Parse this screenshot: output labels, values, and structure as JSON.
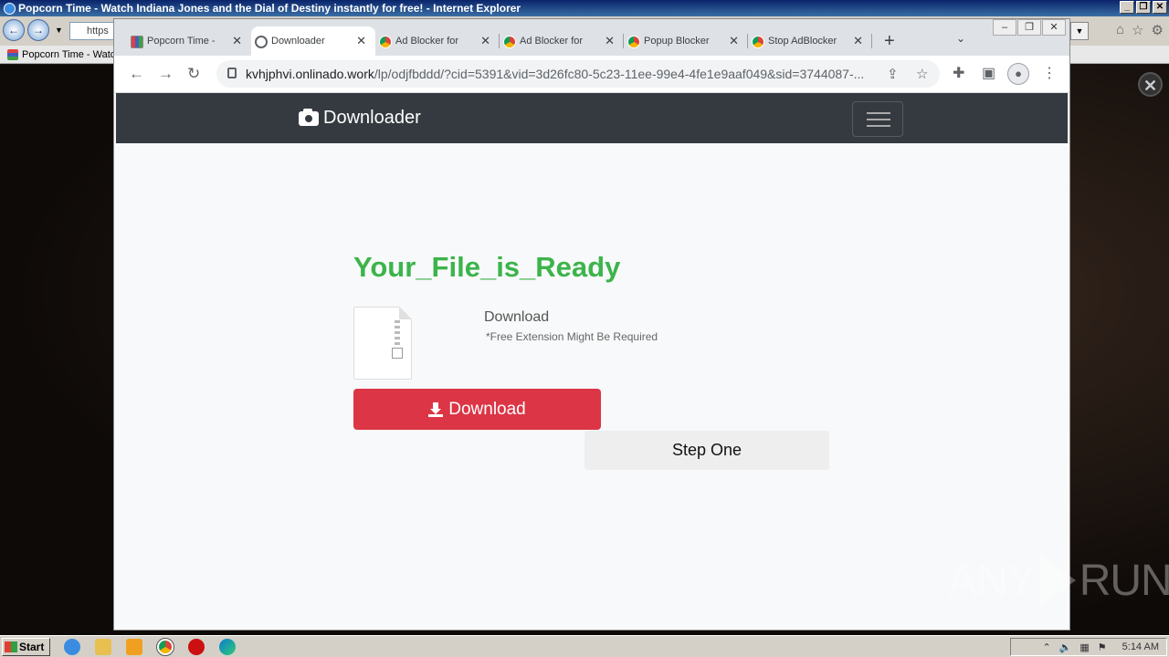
{
  "ie": {
    "title": "Popcorn Time - Watch Indiana Jones and the Dial of Destiny instantly for free! - Internet Explorer",
    "address_partial": "https",
    "tab_label": "Popcorn Time - Watc",
    "close_overlay": "✕"
  },
  "chrome": {
    "tabs": [
      {
        "label": "Popcorn Time -",
        "favicon": "popcorn-icon",
        "active": false
      },
      {
        "label": "Downloader",
        "favicon": "globe-icon",
        "active": true
      },
      {
        "label": "Ad Blocker for",
        "favicon": "chromium-icon",
        "active": false
      },
      {
        "label": "Ad Blocker for",
        "favicon": "chromium-icon",
        "active": false
      },
      {
        "label": "Popup Blocker",
        "favicon": "chromium-icon",
        "active": false
      },
      {
        "label": "Stop AdBlocker",
        "favicon": "chromium-icon",
        "active": false
      }
    ],
    "tab_close": "✕",
    "new_tab": "+",
    "tab_search": "⌄",
    "url_host": "kvhjphvi.onlinado.work",
    "url_path": "/lp/odjfbddd/?cid=5391&vid=3d26fc80-5c23-11ee-99e4-4fe1e9aaf049&sid=3744087-..."
  },
  "site": {
    "brand": "Downloader",
    "title": "Your_File_is_Ready",
    "download_heading": "Download",
    "download_note": "*Free Extension Might Be Required",
    "download_button": "Download",
    "step_button": "Step One"
  },
  "watermark": {
    "left": "ANY",
    "right": "RUN"
  },
  "taskbar": {
    "start": "Start",
    "clock": "5:14 AM"
  },
  "colors": {
    "title_green": "#3cb44b",
    "button_red": "#dc3545",
    "navbar_dark": "#343a40"
  }
}
